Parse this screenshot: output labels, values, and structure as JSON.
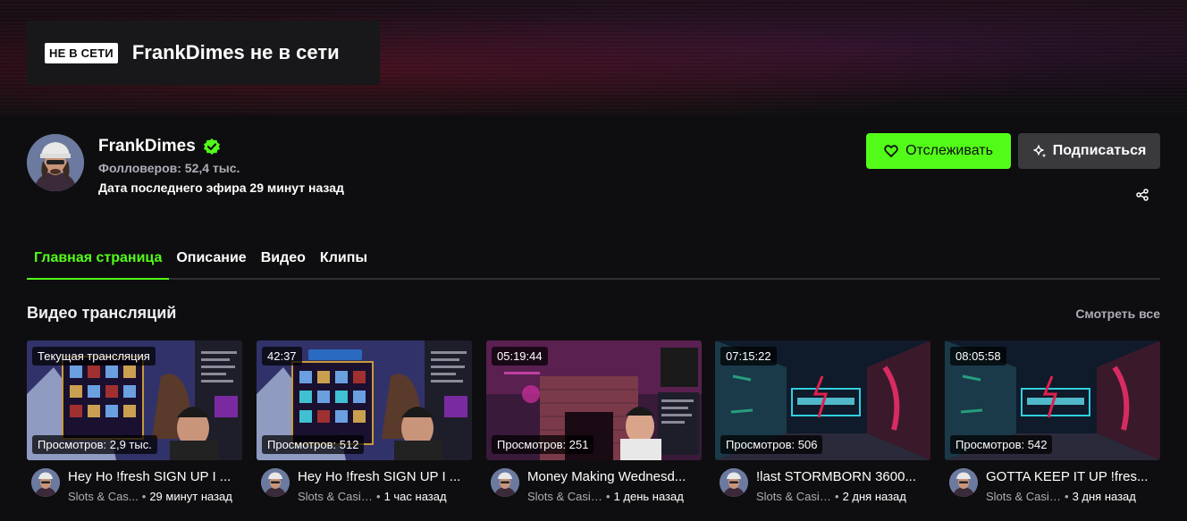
{
  "banner": {
    "offline_badge": "НЕ В СЕТИ",
    "offline_title": "FrankDimes не в сети"
  },
  "channel": {
    "name": "FrankDimes",
    "followers": "Фолловеров: 52,4 тыс.",
    "last_stream": "Дата последнего эфира 29 минут назад",
    "follow_label": "Отслеживать",
    "subscribe_label": "Подписаться",
    "accent_color": "#53fc18",
    "verified_icon": "verified-check-icon"
  },
  "tabs": [
    {
      "label": "Главная страница",
      "active": true
    },
    {
      "label": "Описание",
      "active": false
    },
    {
      "label": "Видео",
      "active": false
    },
    {
      "label": "Клипы",
      "active": false
    }
  ],
  "section": {
    "title": "Видео трансляций",
    "see_all": "Смотреть все"
  },
  "videos": [
    {
      "badge": "Текущая трансляция",
      "views": "Просмотров: 2,9 тыс.",
      "title": "Hey Ho !fresh SIGN UP I ...",
      "category": "Slots & Cas...",
      "time": "29 минут назад"
    },
    {
      "badge": "42:37",
      "views": "Просмотров: 512",
      "title": "Hey Ho !fresh SIGN UP I ...",
      "category": "Slots & Casino",
      "time": "1 час назад"
    },
    {
      "badge": "05:19:44",
      "views": "Просмотров: 251",
      "title": "Money Making Wednesd...",
      "category": "Slots & Casino",
      "time": "1 день назад"
    },
    {
      "badge": "07:15:22",
      "views": "Просмотров: 506",
      "title": "!last STORMBORN 3600...",
      "category": "Slots & Casino",
      "time": "2 дня назад"
    },
    {
      "badge": "08:05:58",
      "views": "Просмотров: 542",
      "title": "GOTTA KEEP IT UP !fres...",
      "category": "Slots & Casino",
      "time": "3 дня назад"
    }
  ]
}
